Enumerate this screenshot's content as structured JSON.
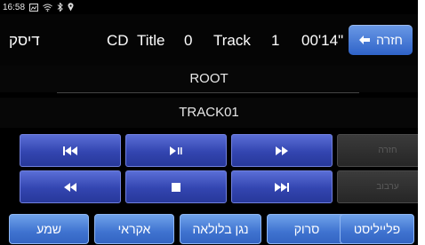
{
  "status_bar": {
    "time": "16:58",
    "icons": [
      "screenshot-icon",
      "wifi-icon",
      "bluetooth-icon",
      "location-icon"
    ]
  },
  "header": {
    "source_label": "דיסק",
    "media_type": "CD",
    "title_label": "Title",
    "title_number": "0",
    "track_label": "Track",
    "track_number": "1",
    "elapsed": "00'14\"",
    "back_label": "חזרה"
  },
  "folder": "ROOT",
  "track_name": "TRACK01",
  "controls": {
    "row1": [
      "previous-track",
      "play-pause",
      "fast-forward",
      "disabled"
    ],
    "row2": [
      "rewind",
      "stop",
      "next-track",
      "disabled"
    ],
    "disabled_labels": [
      "חזרה",
      "ערבוב"
    ]
  },
  "bottom_buttons": [
    "שמע",
    "אקראי",
    "נגן בלולאה",
    "סרוק",
    "פלייליסט"
  ]
}
